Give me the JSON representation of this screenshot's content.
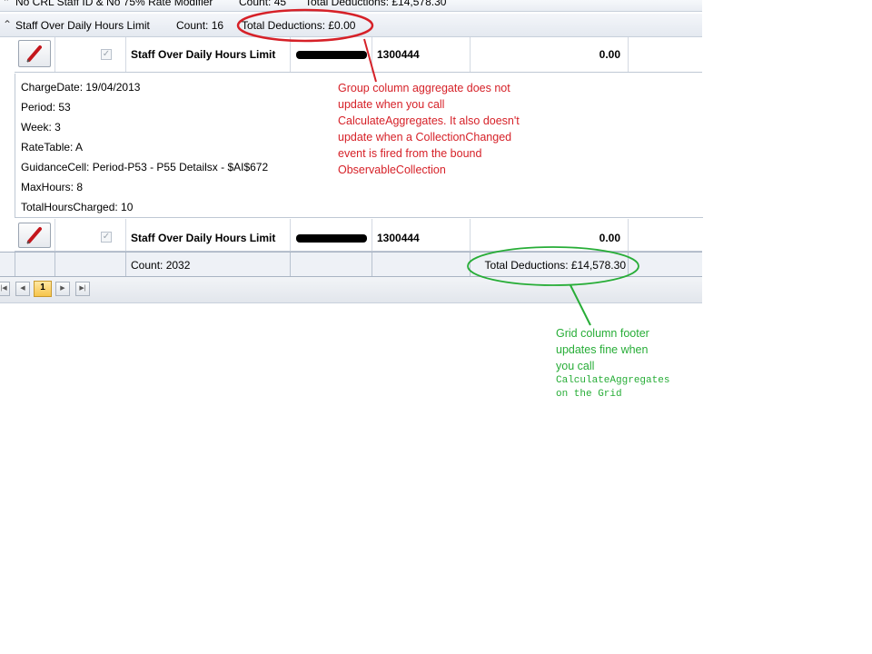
{
  "top_group": {
    "title": "No CRL Staff ID & No 75% Rate Modifier",
    "count": "Count:  45",
    "total": "Total Deductions:  £14,578.30"
  },
  "group": {
    "title": "Staff Over Daily Hours Limit",
    "count": "Count:  16",
    "total": "Total Deductions:  £0.00"
  },
  "rows": [
    {
      "name": "Staff Over Daily Hours Limit",
      "code": "1300444",
      "amount": "0.00"
    },
    {
      "name": "Staff Over Daily Hours Limit",
      "code": "1300444",
      "amount": "0.00"
    }
  ],
  "details": [
    "ChargeDate: 19/04/2013",
    "Period: 53",
    "Week: 3",
    "RateTable: A",
    "GuidanceCell: Period-P53 - P55 Detailsx - $AI$672",
    "MaxHours: 8",
    "TotalHoursCharged: 10"
  ],
  "footer": {
    "count": "Count: 2032",
    "total": "Total Deductions:  £14,578.30"
  },
  "pager": {
    "current_page": "1"
  },
  "annotations": {
    "red": [
      "Group column aggregate does not",
      "update when you call",
      "CalculateAggregates.  It also doesn't",
      "update when a CollectionChanged",
      "event is fired from the bound",
      "ObservableCollection"
    ],
    "green": [
      "Grid column footer",
      "updates fine when",
      "you call"
    ],
    "green_code": [
      "CalculateAggregates",
      "on the Grid"
    ]
  },
  "colors": {
    "annotation_red": "#d62128",
    "annotation_green": "#27ad37"
  }
}
